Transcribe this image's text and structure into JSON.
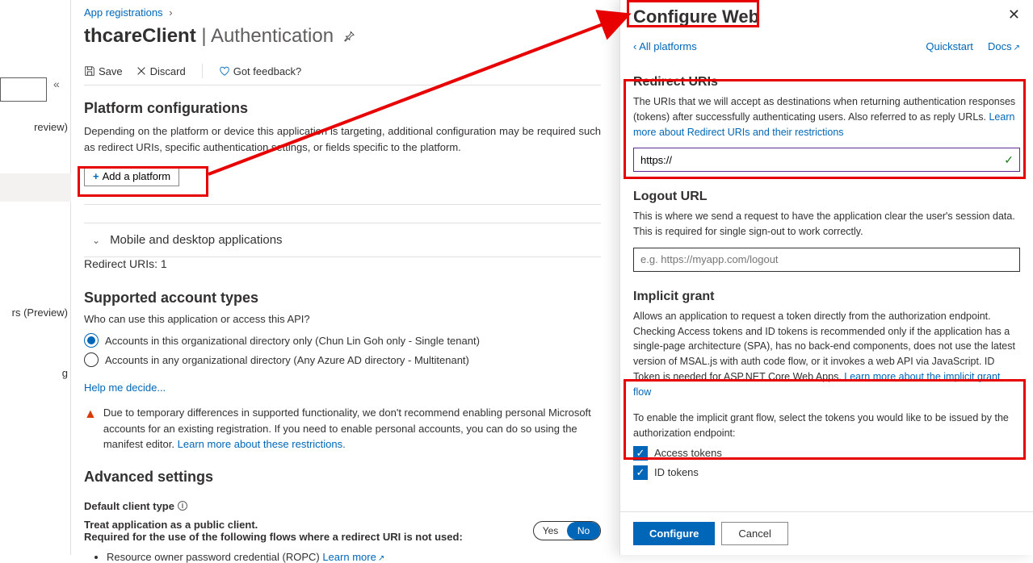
{
  "breadcrumb": {
    "item1": "App registrations"
  },
  "page": {
    "title_app": "thcareClient",
    "title_sep": " | ",
    "title_page": "Authentication"
  },
  "toolbar": {
    "save": "Save",
    "discard": "Discard",
    "feedback": "Got feedback?"
  },
  "left": {
    "collapse": "«",
    "items": [
      "review)",
      "",
      "rs (Preview)",
      "g"
    ],
    "selected_index": 1
  },
  "platforms": {
    "heading": "Platform configurations",
    "desc": "Depending on the platform or device this application is targeting, additional configuration may be required such as redirect URIs, specific authentication settings, or fields specific to the platform.",
    "add_btn": "Add a platform",
    "row": {
      "name": "Mobile and desktop applications",
      "sub": "Redirect URIs: 1"
    }
  },
  "accounts": {
    "heading": "Supported account types",
    "question": "Who can use this application or access this API?",
    "opt1": "Accounts in this organizational directory only (Chun Lin Goh only - Single tenant)",
    "opt2": "Accounts in any organizational directory (Any Azure AD directory - Multitenant)",
    "help": "Help me decide...",
    "warning": "Due to temporary differences in supported functionality, we don't recommend enabling personal Microsoft accounts for an existing registration. If you need to enable personal accounts, you can do so using the manifest editor. ",
    "warning_link": "Learn more about these restrictions."
  },
  "advanced": {
    "heading": "Advanced settings",
    "default_client": "Default client type",
    "public_title": "Treat application as a public client.",
    "public_desc": "Required for the use of the following flows where a redirect URI is not used:",
    "toggle_yes": "Yes",
    "toggle_no": "No",
    "bullet1": "Resource owner password credential (ROPC) ",
    "bullet1_link": "Learn more"
  },
  "panel": {
    "title": "Configure Web",
    "all_platforms": "All platforms",
    "quickstart": "Quickstart",
    "docs": "Docs",
    "redirect": {
      "heading": "Redirect URIs",
      "desc": "The URIs that we will accept as destinations when returning authentication responses (tokens) after successfully authenticating users. Also referred to as reply URLs. ",
      "link": "Learn more about Redirect URIs and their restrictions",
      "value": "https://"
    },
    "logout": {
      "heading": "Logout URL",
      "desc": "This is where we send a request to have the application clear the user's session data. This is required for single sign-out to work correctly.",
      "placeholder": "e.g. https://myapp.com/logout"
    },
    "implicit": {
      "heading": "Implicit grant",
      "desc": "Allows an application to request a token directly from the authorization endpoint. Checking Access tokens and ID tokens is recommended only if the application has a single-page architecture (SPA), has no back-end components, does not use the latest version of MSAL.js with auth code flow, or it invokes a web API via JavaScript. ID Token is needed for ASP.NET Core Web Apps. ",
      "link": "Learn more about the implicit grant flow",
      "enable_text": "To enable the implicit grant flow, select the tokens you would like to be issued by the authorization endpoint:",
      "access": "Access tokens",
      "id": "ID tokens"
    },
    "footer": {
      "configure": "Configure",
      "cancel": "Cancel"
    }
  }
}
